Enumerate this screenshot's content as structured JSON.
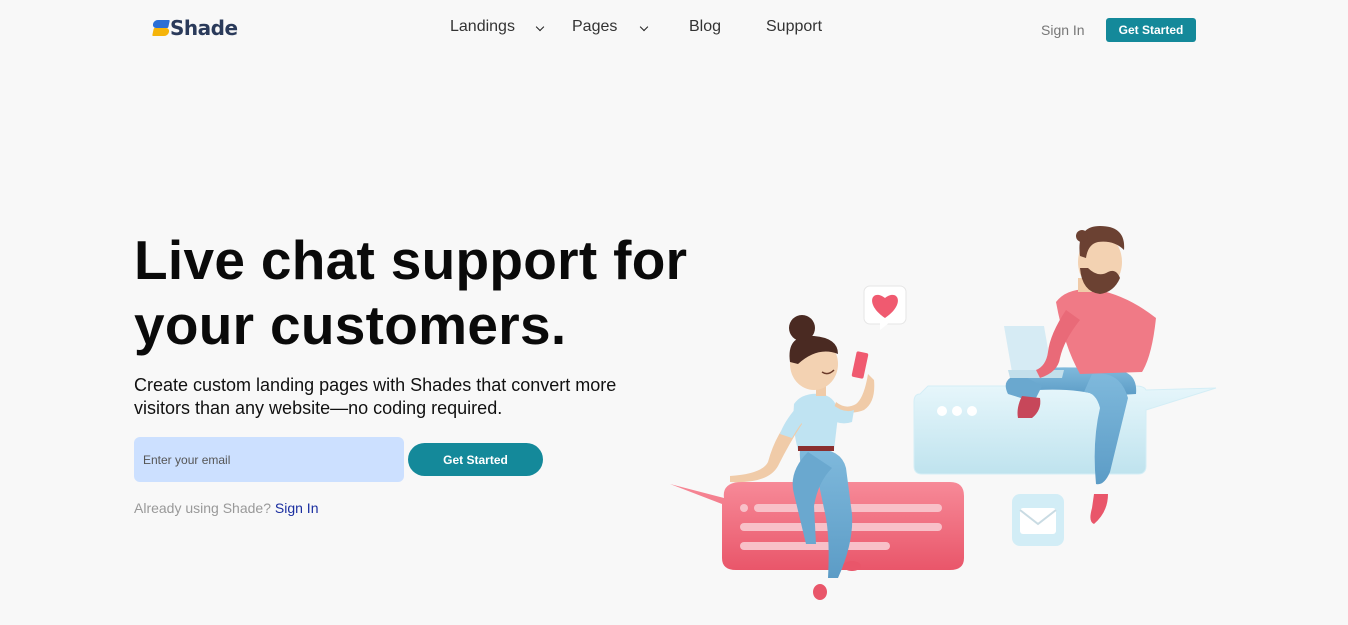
{
  "header": {
    "logo_text": "Shade",
    "nav": [
      {
        "label": "Landings",
        "has_dropdown": true
      },
      {
        "label": "Pages",
        "has_dropdown": true
      },
      {
        "label": "Blog",
        "has_dropdown": false
      },
      {
        "label": "Support",
        "has_dropdown": false
      }
    ],
    "sign_in": "Sign In",
    "cta": "Get Started"
  },
  "hero": {
    "title": "Live chat support for your customers.",
    "subtitle": "Create custom landing pages with Shades that convert more visitors than any website—no coding required.",
    "email_placeholder": "Enter your email",
    "cta": "Get Started",
    "already_text": "Already using Shade?",
    "sign_in_link": "Sign In"
  },
  "colors": {
    "accent": "#14899a",
    "input_bg": "#cce0ff",
    "link": "#1a2ea0",
    "logo_blue": "#2b6fd6",
    "logo_yellow": "#f5b40a"
  },
  "illustration": {
    "icons": [
      "heart-icon",
      "envelope-icon",
      "chat-bubble-icon"
    ]
  }
}
